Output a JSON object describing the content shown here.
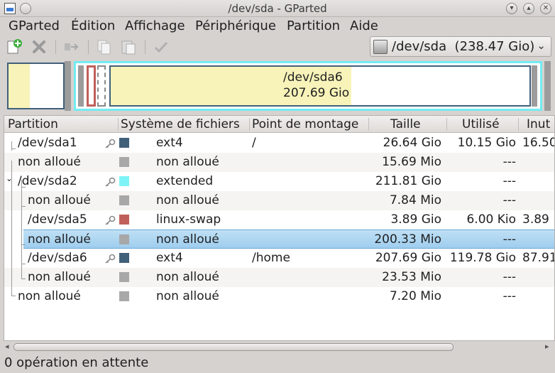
{
  "window": {
    "title": "/dev/sda - GParted"
  },
  "menu": [
    "GParted",
    "Édition",
    "Affichage",
    "Périphérique",
    "Partition",
    "Aide"
  ],
  "device": {
    "label": "/dev/sda  (238.47 Gio)"
  },
  "diskmap": {
    "selected_name": "/dev/sda6",
    "selected_size": "207.69 Gio"
  },
  "columns": [
    "Partition",
    "Système de fichiers",
    "Point de montage",
    "Taille",
    "Utilisé",
    "Inut"
  ],
  "rows": [
    {
      "partition": "/dev/sda1",
      "fs": "ext4",
      "mount": "/",
      "size": "26.64 Gio",
      "used": "10.15 Gio",
      "unused": "16.50",
      "color": "#41607a",
      "locked": true
    },
    {
      "partition": "non alloué",
      "fs": "non alloué",
      "mount": "",
      "size": "15.69 Mio",
      "used": "---",
      "unused": "",
      "color": "#a8a8a8",
      "locked": false
    },
    {
      "partition": "/dev/sda2",
      "fs": "extended",
      "mount": "",
      "size": "211.81 Gio",
      "used": "---",
      "unused": "",
      "color": "#7df3f7",
      "locked": true
    },
    {
      "partition": "non alloué",
      "fs": "non alloué",
      "mount": "",
      "size": "7.84 Mio",
      "used": "---",
      "unused": "",
      "color": "#a8a8a8",
      "locked": false
    },
    {
      "partition": "/dev/sda5",
      "fs": "linux-swap",
      "mount": "",
      "size": "3.89 Gio",
      "used": "6.00 Kio",
      "unused": "3.89",
      "color": "#c0605a",
      "locked": true
    },
    {
      "partition": "non alloué",
      "fs": "non alloué",
      "mount": "",
      "size": "200.33 Mio",
      "used": "---",
      "unused": "",
      "color": "#a8a8a8",
      "locked": false
    },
    {
      "partition": "/dev/sda6",
      "fs": "ext4",
      "mount": "/home",
      "size": "207.69 Gio",
      "used": "119.78 Gio",
      "unused": "87.91",
      "color": "#41607a",
      "locked": true
    },
    {
      "partition": "non alloué",
      "fs": "non alloué",
      "mount": "",
      "size": "23.53 Mio",
      "used": "---",
      "unused": "",
      "color": "#a8a8a8",
      "locked": false
    },
    {
      "partition": "non alloué",
      "fs": "non alloué",
      "mount": "",
      "size": "7.20 Mio",
      "used": "---",
      "unused": "",
      "color": "#a8a8a8",
      "locked": false
    }
  ],
  "status": "0 opération en attente"
}
